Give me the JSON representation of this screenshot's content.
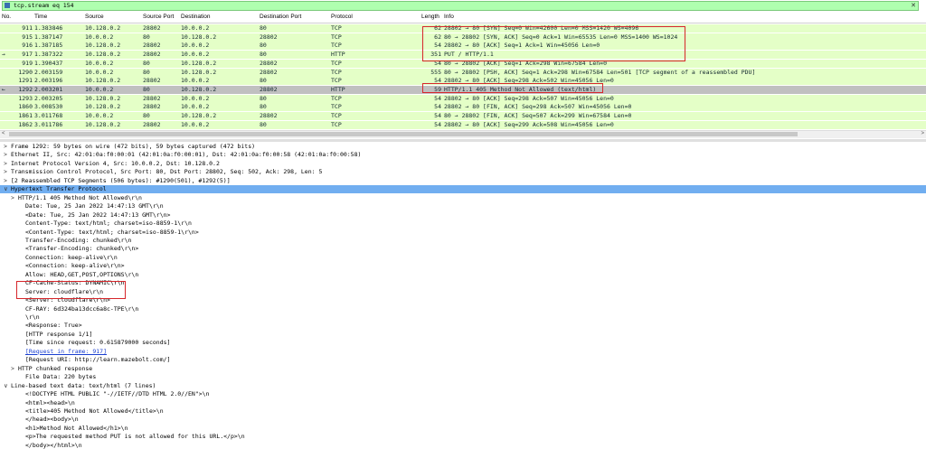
{
  "filter": {
    "value": "tcp.stream eq 154"
  },
  "columns": [
    "No.",
    "Time",
    "Source",
    "Source Port",
    "Destination",
    "Destination Port",
    "Protocol",
    "Length",
    "Info"
  ],
  "packets": [
    {
      "mark": "",
      "no": "911",
      "time": "1.383846",
      "src": "10.128.0.2",
      "sport": "28802",
      "dst": "10.0.0.2",
      "dport": "80",
      "proto": "TCP",
      "len": "62",
      "info": "28802 → 80 [SYN] Seq=0 Win=42600 Len=0 MSS=1420 WS=4096"
    },
    {
      "mark": "",
      "no": "915",
      "time": "1.387147",
      "src": "10.0.0.2",
      "sport": "80",
      "dst": "10.128.0.2",
      "dport": "28802",
      "proto": "TCP",
      "len": "62",
      "info": "80 → 28802 [SYN, ACK] Seq=0 Ack=1 Win=65535 Len=0 MSS=1400 WS=1024"
    },
    {
      "mark": "",
      "no": "916",
      "time": "1.387185",
      "src": "10.128.0.2",
      "sport": "28802",
      "dst": "10.0.0.2",
      "dport": "80",
      "proto": "TCP",
      "len": "54",
      "info": "28802 → 80 [ACK] Seq=1 Ack=1 Win=45056 Len=0"
    },
    {
      "mark": "→",
      "no": "917",
      "time": "1.387322",
      "src": "10.128.0.2",
      "sport": "28802",
      "dst": "10.0.0.2",
      "dport": "80",
      "proto": "HTTP",
      "len": "351",
      "info": "PUT / HTTP/1.1"
    },
    {
      "mark": "",
      "no": "919",
      "time": "1.390437",
      "src": "10.0.0.2",
      "sport": "80",
      "dst": "10.128.0.2",
      "dport": "28802",
      "proto": "TCP",
      "len": "54",
      "info": "80 → 28802 [ACK] Seq=1 Ack=298 Win=67584 Len=0"
    },
    {
      "mark": "",
      "no": "1290",
      "time": "2.003159",
      "src": "10.0.0.2",
      "sport": "80",
      "dst": "10.128.0.2",
      "dport": "28802",
      "proto": "TCP",
      "len": "555",
      "info": "80 → 28802 [PSH, ACK] Seq=1 Ack=298 Win=67584 Len=501 [TCP segment of a reassembled PDU]"
    },
    {
      "mark": "",
      "no": "1291",
      "time": "2.003196",
      "src": "10.128.0.2",
      "sport": "28802",
      "dst": "10.0.0.2",
      "dport": "80",
      "proto": "TCP",
      "len": "54",
      "info": "28802 → 80 [ACK] Seq=298 Ack=502 Win=45056 Len=0"
    },
    {
      "mark": "←",
      "no": "1292",
      "time": "2.003201",
      "src": "10.0.0.2",
      "sport": "80",
      "dst": "10.128.0.2",
      "dport": "28802",
      "proto": "HTTP",
      "len": "59",
      "info": "HTTP/1.1 405 Method Not Allowed  (text/html)"
    },
    {
      "mark": "",
      "no": "1293",
      "time": "2.003205",
      "src": "10.128.0.2",
      "sport": "28802",
      "dst": "10.0.0.2",
      "dport": "80",
      "proto": "TCP",
      "len": "54",
      "info": "28802 → 80 [ACK] Seq=298 Ack=507 Win=45056 Len=0"
    },
    {
      "mark": "",
      "no": "1860",
      "time": "3.008530",
      "src": "10.128.0.2",
      "sport": "28802",
      "dst": "10.0.0.2",
      "dport": "80",
      "proto": "TCP",
      "len": "54",
      "info": "28802 → 80 [FIN, ACK] Seq=298 Ack=507 Win=45056 Len=0"
    },
    {
      "mark": "",
      "no": "1861",
      "time": "3.011768",
      "src": "10.0.0.2",
      "sport": "80",
      "dst": "10.128.0.2",
      "dport": "28802",
      "proto": "TCP",
      "len": "54",
      "info": "80 → 28802 [FIN, ACK] Seq=507 Ack=299 Win=67584 Len=0"
    },
    {
      "mark": "",
      "no": "1862",
      "time": "3.011786",
      "src": "10.128.0.2",
      "sport": "28802",
      "dst": "10.0.0.2",
      "dport": "80",
      "proto": "TCP",
      "len": "54",
      "info": "28802 → 80 [ACK] Seq=299 Ack=508 Win=45056 Len=0"
    }
  ],
  "details": [
    {
      "a": ">",
      "t": "Frame 1292: 59 bytes on wire (472 bits), 59 bytes captured (472 bits)"
    },
    {
      "a": ">",
      "t": "Ethernet II, Src: 42:01:0a:f0:00:01 (42:01:0a:f0:00:01), Dst: 42:01:0a:f0:00:58 (42:01:0a:f0:00:58)"
    },
    {
      "a": ">",
      "t": "Internet Protocol Version 4, Src: 10.0.0.2, Dst: 10.128.0.2"
    },
    {
      "a": ">",
      "t": "Transmission Control Protocol, Src Port: 80, Dst Port: 28802, Seq: 502, Ack: 298, Len: 5"
    },
    {
      "a": ">",
      "t": "[2 Reassembled TCP Segments (506 bytes): #1290(501), #1292(5)]"
    },
    {
      "a": "∨",
      "t": "Hypertext Transfer Protocol"
    },
    {
      "a": ">",
      "t": "HTTP/1.1 405 Method Not Allowed\\r\\n"
    },
    {
      "a": "",
      "t": "Date: Tue, 25 Jan 2022 14:47:13 GMT\\r\\n"
    },
    {
      "a": "",
      "t": "<Date: Tue, 25 Jan 2022 14:47:13 GMT\\r\\n>"
    },
    {
      "a": "",
      "t": "Content-Type: text/html; charset=iso-8859-1\\r\\n"
    },
    {
      "a": "",
      "t": "<Content-Type: text/html; charset=iso-8859-1\\r\\n>"
    },
    {
      "a": "",
      "t": "Transfer-Encoding: chunked\\r\\n"
    },
    {
      "a": "",
      "t": "<Transfer-Encoding: chunked\\r\\n>"
    },
    {
      "a": "",
      "t": "Connection: keep-alive\\r\\n"
    },
    {
      "a": "",
      "t": "<Connection: keep-alive\\r\\n>"
    },
    {
      "a": "",
      "t": "Allow: HEAD,GET,POST,OPTIONS\\r\\n"
    },
    {
      "a": "",
      "t": "CF-Cache-Status: DYNAMIC\\r\\n"
    },
    {
      "a": "",
      "t": "Server: cloudflare\\r\\n"
    },
    {
      "a": "",
      "t": "<Server: cloudflare\\r\\n>"
    },
    {
      "a": "",
      "t": "CF-RAY: 6d324ba13dcc6a8c-TPE\\r\\n"
    },
    {
      "a": "",
      "t": "\\r\\n"
    },
    {
      "a": "",
      "t": "<Response: True>"
    },
    {
      "a": "",
      "t": "[HTTP response 1/1]"
    },
    {
      "a": "",
      "t": "[Time since request: 0.615879000 seconds]"
    },
    {
      "a": "",
      "t": "[Request in frame: 917]",
      "link": true
    },
    {
      "a": "",
      "t": "[Request URI: http://learn.mazebolt.com/]"
    },
    {
      "a": ">",
      "t": "HTTP chunked response"
    },
    {
      "a": "",
      "t": "File Data: 220 bytes"
    },
    {
      "a": "∨",
      "t": "Line-based text data: text/html (7 lines)"
    },
    {
      "a": "",
      "t": "<!DOCTYPE HTML PUBLIC \"-//IETF//DTD HTML 2.0//EN\">\\n"
    },
    {
      "a": "",
      "t": "<html><head>\\n"
    },
    {
      "a": "",
      "t": "<title>405 Method Not Allowed</title>\\n"
    },
    {
      "a": "",
      "t": "</head><body>\\n"
    },
    {
      "a": "",
      "t": "<h1>Method Not Allowed</h1>\\n"
    },
    {
      "a": "",
      "t": "<p>The requested method PUT is not allowed for this URL.</p>\\n"
    },
    {
      "a": "",
      "t": "</body></html>\\n"
    }
  ],
  "colors": {
    "tcp_row": "#e4ffc7",
    "selected_row": "#c0c0c0",
    "filter_bg": "#afffaf",
    "highlight": "#71aef0",
    "annotation": "#d6262b"
  }
}
